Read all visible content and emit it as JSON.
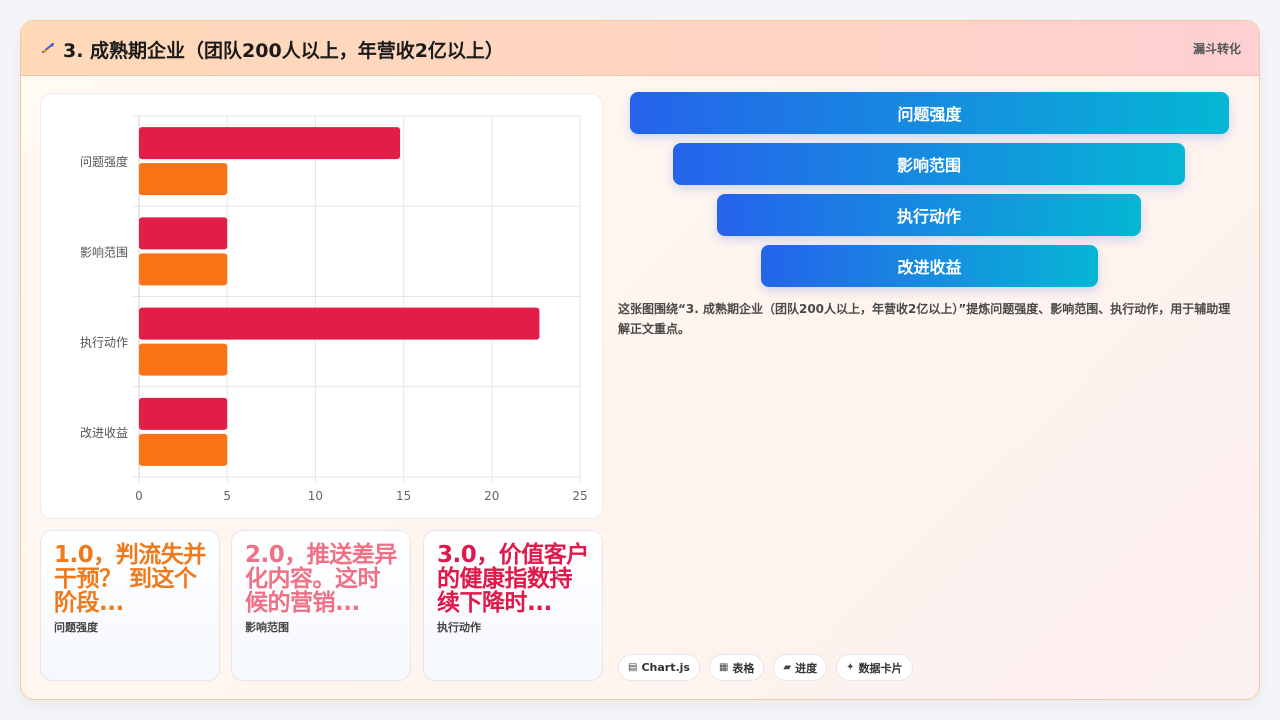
{
  "header": {
    "title": "3. 成熟期企业（团队200人以上，年营收2亿以上）",
    "badge": "漏斗转化"
  },
  "chart_data": {
    "type": "bar",
    "orientation": "horizontal",
    "categories": [
      "问题强度",
      "影响范围",
      "执行动作",
      "改进收益"
    ],
    "series": [
      {
        "color": "#e11d48",
        "values": [
          14.8,
          5,
          22.7,
          5
        ]
      },
      {
        "color": "#f97316",
        "values": [
          5,
          5,
          5,
          5
        ]
      }
    ],
    "xlim": [
      0,
      25
    ],
    "xticks": [
      "0",
      "5",
      "10",
      "15",
      "20",
      "25"
    ],
    "grid": true,
    "legend": "none"
  },
  "stats": [
    {
      "value": "1.0，判流失并干预？ 到这个阶段...",
      "label": "问题强度",
      "color": "#f07a1a"
    },
    {
      "value": "2.0，推送差异化内容。这时候的营销...",
      "label": "影响范围",
      "color": "#f07186"
    },
    {
      "value": "3.0，价值客户的健康指数持续下降时...",
      "label": "执行动作",
      "color": "#e0194a"
    }
  ],
  "funnel": [
    "问题强度",
    "影响范围",
    "执行动作",
    "改进收益"
  ],
  "description": "这张图围绕“3. 成熟期企业（团队200人以上，年营收2亿以上）”提炼问题强度、影响范围、执行动作，用于辅助理解正文重点。",
  "chips": [
    {
      "icon": "▤",
      "label": "Chart.js"
    },
    {
      "icon": "▦",
      "label": "表格"
    },
    {
      "icon": "▰",
      "label": "进度"
    },
    {
      "icon": "✦",
      "label": "数据卡片"
    }
  ],
  "colors": {
    "accent_red": "#e11d48",
    "accent_orange": "#f97316",
    "funnel_start": "#2563eb",
    "funnel_end": "#06b6d4"
  }
}
